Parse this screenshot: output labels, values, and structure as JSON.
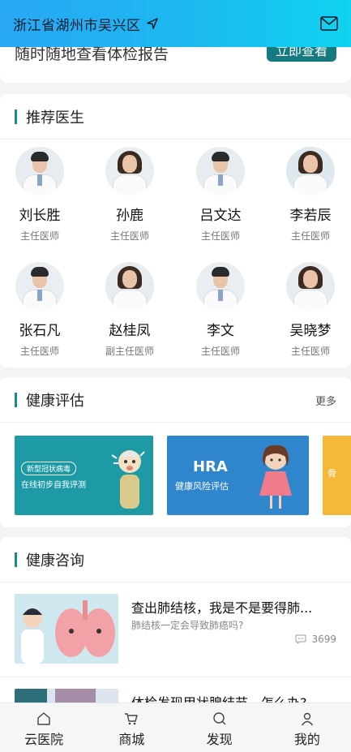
{
  "header": {
    "location": "浙江省湖州市吴兴区"
  },
  "report": {
    "text": "随时随地查看体检报告",
    "button": "立即查看"
  },
  "doctors_section": {
    "title": "推荐医生",
    "doctors": [
      {
        "name": "刘长胜",
        "title": "主任医师"
      },
      {
        "name": "孙鹿",
        "title": "主任医师"
      },
      {
        "name": "吕文达",
        "title": "主任医师"
      },
      {
        "name": "李若辰",
        "title": "主任医师"
      },
      {
        "name": "张石凡",
        "title": "主任医师"
      },
      {
        "name": "赵桂凤",
        "title": "副主任医师"
      },
      {
        "name": "李文",
        "title": "主任医师"
      },
      {
        "name": "吴晓梦",
        "title": "主任医师"
      }
    ]
  },
  "assessment": {
    "title": "健康评估",
    "more": "更多",
    "banners": [
      {
        "tag": "新型冠状病毒",
        "line": "在线初步自我评测"
      },
      {
        "heading": "HRA",
        "sub": "健康风险评估"
      },
      {
        "text": "骨"
      }
    ]
  },
  "consult": {
    "title": "健康咨询",
    "articles": [
      {
        "title": "查出肺结核，我是不是要得肺...",
        "sub": "肺结核一定会导致肺癌吗?",
        "count": "3699"
      },
      {
        "title": "体检发现甲状腺结节，怎么办?"
      }
    ]
  },
  "tabs": [
    {
      "label": "云医院",
      "icon": "home-icon"
    },
    {
      "label": "商城",
      "icon": "cart-icon"
    },
    {
      "label": "发现",
      "icon": "search-icon"
    },
    {
      "label": "我的",
      "icon": "user-icon"
    }
  ],
  "colors": {
    "header_start": "#29a7f5",
    "header_end": "#10d3f0",
    "accent": "#1a8a92",
    "button": "#157a80"
  }
}
